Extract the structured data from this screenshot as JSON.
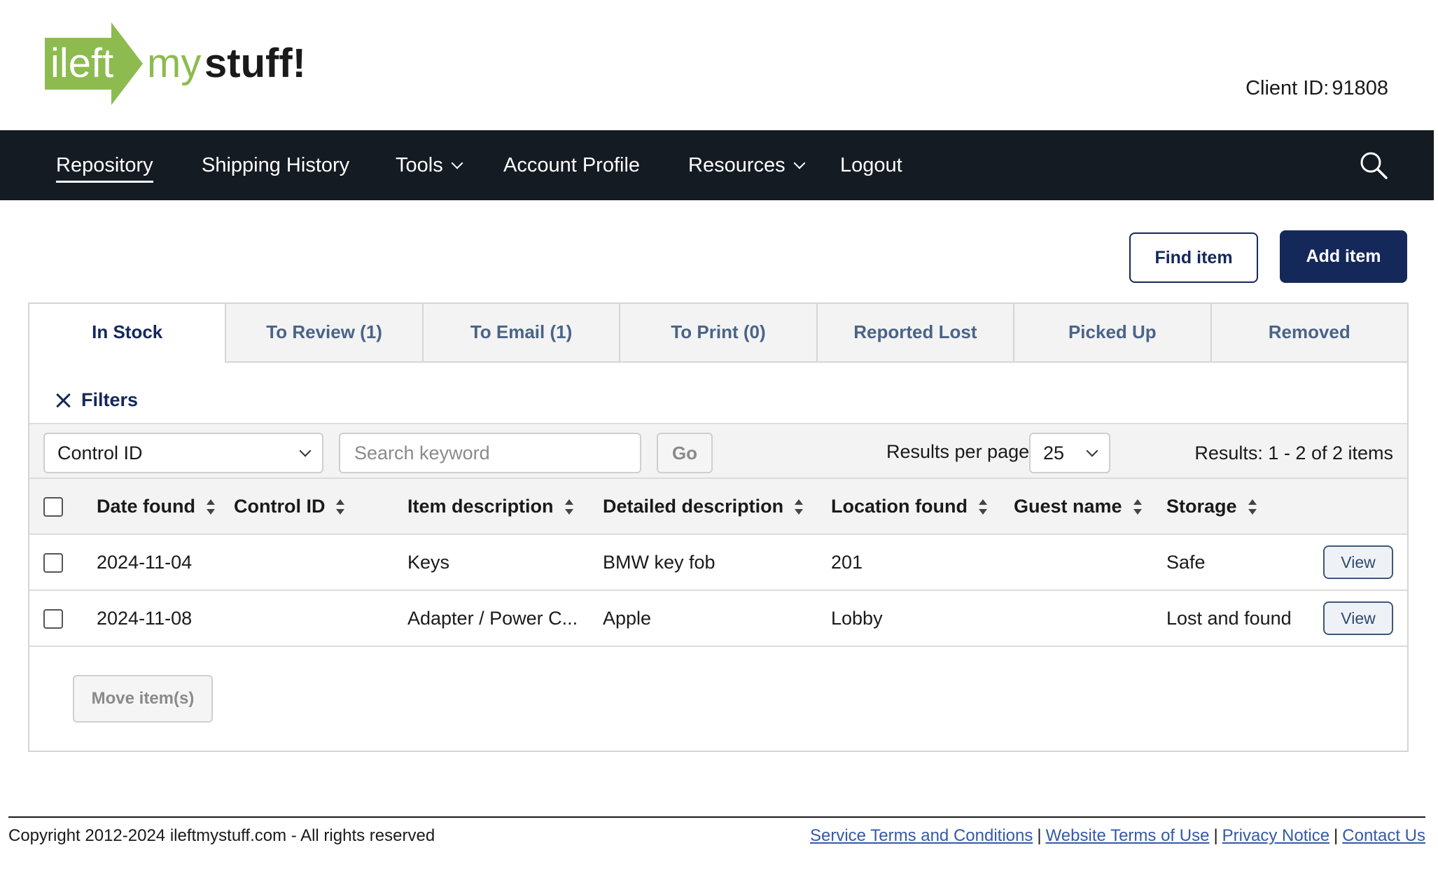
{
  "brand": {
    "logo_text_part1": "ileft",
    "logo_text_part2": "my",
    "logo_text_part3": "stuff!",
    "logo_green": "#8dbb4f",
    "navy": "#14285a"
  },
  "header": {
    "client_label": "Client ID:",
    "client_id": "91808"
  },
  "nav": {
    "items": [
      {
        "label": "Repository",
        "active": true
      },
      {
        "label": "Shipping History"
      },
      {
        "label": "Tools",
        "dropdown": true
      },
      {
        "label": "Account Profile"
      },
      {
        "label": "Resources",
        "dropdown": true
      },
      {
        "label": "Logout"
      }
    ],
    "search_icon": "search-icon"
  },
  "actions": {
    "find_item": "Find item",
    "add_item": "Add item"
  },
  "tabs": [
    {
      "label": "In Stock",
      "active": true
    },
    {
      "label": "To Review (1)"
    },
    {
      "label": "To Email (1)"
    },
    {
      "label": "To Print (0)"
    },
    {
      "label": "Reported Lost"
    },
    {
      "label": "Picked Up"
    },
    {
      "label": "Removed"
    }
  ],
  "filters": {
    "toggle_label": "Filters",
    "field_selected": "Control ID",
    "search_placeholder": "Search keyword",
    "go_label": "Go",
    "results_per_page_label": "Results per page:",
    "results_per_page_value": "25",
    "results_text": "Results: 1 - 2 of 2 items"
  },
  "table": {
    "columns": [
      "Date found",
      "Control ID",
      "Item description",
      "Detailed description",
      "Location found",
      "Guest name",
      "Storage"
    ],
    "rows": [
      {
        "date_found": "2024-11-04",
        "control_id": "",
        "item_description": "Keys",
        "detailed_description": "BMW key fob",
        "location_found": "201",
        "guest_name": "",
        "storage": "Safe",
        "action": "View"
      },
      {
        "date_found": "2024-11-08",
        "control_id": "",
        "item_description": "Adapter / Power C...",
        "detailed_description": "Apple",
        "location_found": "Lobby",
        "guest_name": "",
        "storage": "Lost and found",
        "action": "View"
      }
    ],
    "move_label": "Move item(s)"
  },
  "footer": {
    "copyright": "Copyright 2012-2024 ileftmystuff.com - All rights reserved",
    "links": [
      "Service Terms and Conditions",
      "Website Terms of Use",
      "Privacy Notice",
      "Contact Us"
    ],
    "separator": "|"
  }
}
